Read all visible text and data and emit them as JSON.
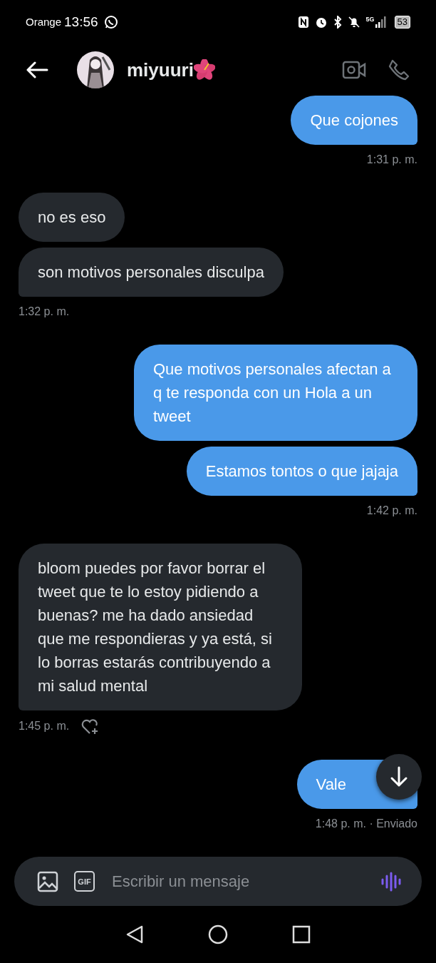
{
  "status_bar": {
    "carrier": "Orange",
    "time": "13:56",
    "network": "5G",
    "battery": "53"
  },
  "header": {
    "name": "miyuuri"
  },
  "groups": [
    {
      "kind": "sent",
      "messages": [
        "Que cojones"
      ],
      "time": "1:31 p. m.",
      "react_button": false
    },
    {
      "kind": "received",
      "messages": [
        "no es eso",
        "son motivos personales disculpa"
      ],
      "time": "1:32 p. m.",
      "react_button": false
    },
    {
      "kind": "sent",
      "messages": [
        "Que motivos personales afectan a q te responda con un Hola a un tweet",
        "Estamos tontos o que jajaja"
      ],
      "time": "1:42 p. m.",
      "react_button": false
    },
    {
      "kind": "received",
      "messages": [
        "bloom puedes por favor borrar el tweet que te lo estoy pidiendo a buenas? me ha dado ansiedad que me respondieras y ya está, si lo borras estarás contribuyendo a mi salud mental"
      ],
      "time": "1:45 p. m.",
      "react_button": true
    },
    {
      "kind": "sent",
      "messages": [
        "Vale"
      ],
      "time": "1:48 p. m. · Enviado",
      "react_button": false,
      "scroll_button": true
    }
  ],
  "composer": {
    "gif_label": "GIF",
    "placeholder": "Escribir un mensaje"
  }
}
